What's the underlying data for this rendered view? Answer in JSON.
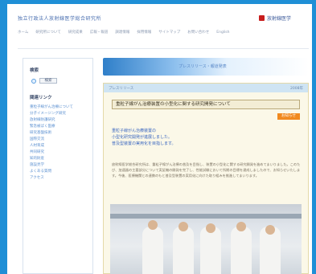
{
  "header": {
    "site_title": "独立行政法人放射線医学総合研究所",
    "logo_text": "放射線医学"
  },
  "nav": [
    "ホーム",
    "研究所について",
    "研究成果",
    "広報・報道",
    "調達情報",
    "採用情報",
    "サイトマップ",
    "お問い合わせ",
    "English"
  ],
  "sidebar": {
    "search_heading": "検索",
    "search_button": "検索",
    "links_heading": "関連リンク",
    "links": [
      "重粒子線がん治療について",
      "分子イメージング研究",
      "放射線防護研究",
      "緊急被ばく医療",
      "研究基盤技術",
      "国際交流",
      "人材育成",
      "共同研究",
      "知的財産",
      "施設見学",
      "よくある質問",
      "アクセス"
    ]
  },
  "banner": {
    "text": "プレスリリース・報道発表"
  },
  "article": {
    "head_left": "プレスリリース",
    "head_right": "2008年",
    "title": "重粒子線がん治療装置の小型化に関する研究開発について",
    "badge": "お知らせ",
    "lead_lines": [
      "重粒子線がん治療装置の",
      "小型化研究開発が進展しました。",
      "普及型装置の実用化を目指します。"
    ],
    "body": "放射線医学総合研究所は、重粒子線がん治療の普及を目指し、装置の小型化に関する研究開発を進めてまいりました。このたび、加速器の主要部分について実証機の開発を完了し、性能試験において所期の目標を達成しましたので、お知らせいたします。今後、医療機関との連携のもと普及型装置の実用化に向けた取り組みを推進してまいります。"
  }
}
